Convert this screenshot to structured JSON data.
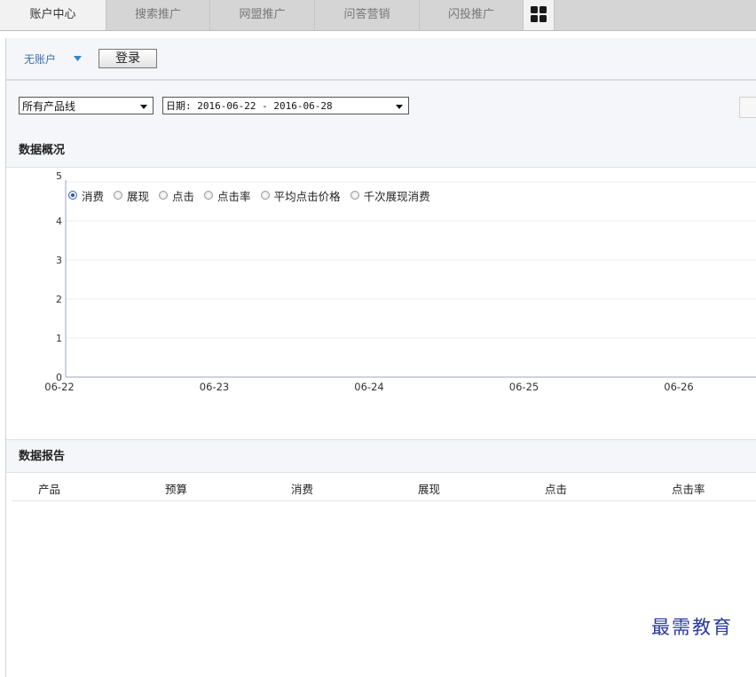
{
  "nav": {
    "tabs": [
      {
        "label": "账户中心",
        "active": true
      },
      {
        "label": "搜索推广",
        "active": false
      },
      {
        "label": "网盟推广",
        "active": false
      },
      {
        "label": "问答营销",
        "active": false
      },
      {
        "label": "闪投推广",
        "active": false
      }
    ],
    "apps_icon": "grid-icon"
  },
  "account": {
    "name": "无账户",
    "login_label": "登录"
  },
  "filters": {
    "product_line": "所有产品线",
    "date_range": "日期: 2016-06-22 - 2016-06-28"
  },
  "overview": {
    "title": "数据概况",
    "metrics": [
      {
        "label": "消费",
        "selected": true
      },
      {
        "label": "展现",
        "selected": false
      },
      {
        "label": "点击",
        "selected": false
      },
      {
        "label": "点击率",
        "selected": false
      },
      {
        "label": "平均点击价格",
        "selected": false
      },
      {
        "label": "千次展现消费",
        "selected": false
      }
    ]
  },
  "chart_data": {
    "type": "line",
    "x": [
      "06-22",
      "06-23",
      "06-24",
      "06-25",
      "06-26"
    ],
    "y_ticks": [
      0,
      1,
      2,
      3,
      4,
      5
    ],
    "ylim": [
      0,
      5
    ],
    "series": [],
    "grid": true
  },
  "report": {
    "title": "数据报告",
    "columns": [
      "产品",
      "预算",
      "消费",
      "展现",
      "点击",
      "点击率"
    ]
  },
  "watermark": "最需教育",
  "colors": {
    "nav_bg": "#d5d5d5",
    "active_tab": "#f2f2f2",
    "link_blue": "#3b6fb6",
    "panel_bg": "#f4f6f9"
  }
}
